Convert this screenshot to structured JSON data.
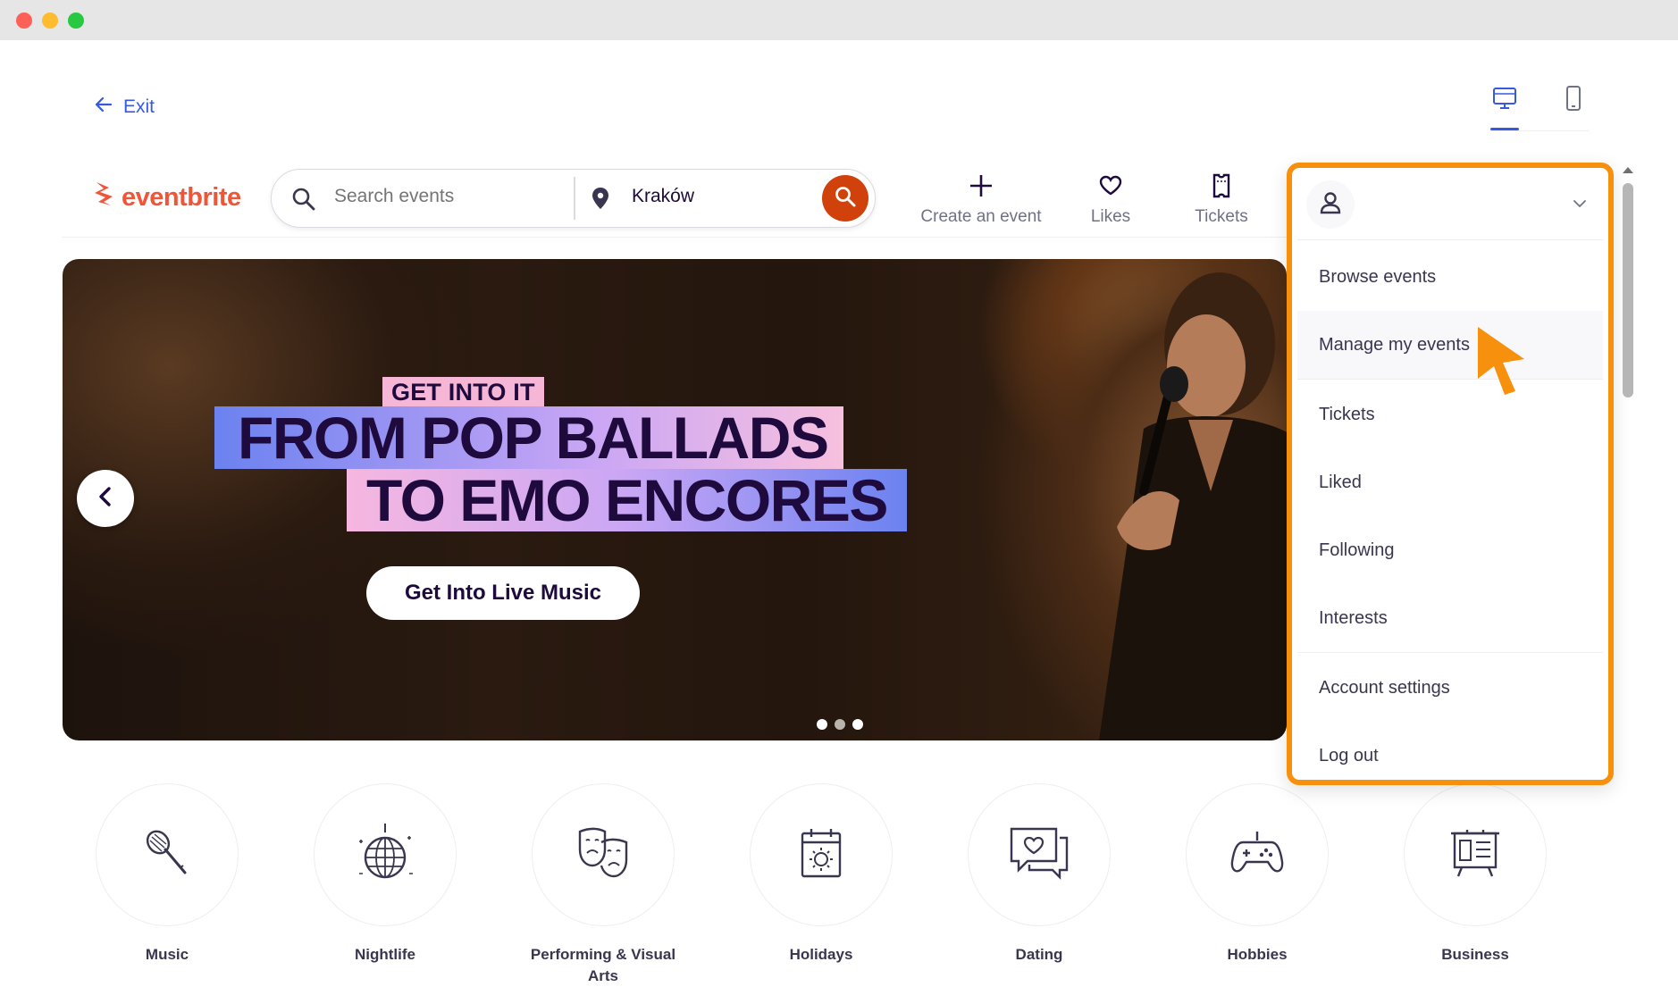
{
  "window": {
    "colors": {
      "close": "#fe5f57",
      "minimize": "#febc2e",
      "maximize": "#28c840"
    }
  },
  "topbar": {
    "exit_label": "Exit",
    "views": [
      {
        "name": "desktop",
        "active": true
      },
      {
        "name": "mobile",
        "active": false
      }
    ]
  },
  "header": {
    "logo_text": "eventbrite",
    "search": {
      "placeholder": "Search events",
      "value": ""
    },
    "location": {
      "value": "Kraków"
    },
    "nav": [
      {
        "label": "Create an event",
        "icon": "plus-icon"
      },
      {
        "label": "Likes",
        "icon": "heart-icon"
      },
      {
        "label": "Tickets",
        "icon": "ticket-icon"
      }
    ]
  },
  "hero": {
    "tag": "GET INTO IT",
    "headline_line1": "FROM POP BALLADS",
    "headline_line2": "TO EMO ENCORES",
    "cta_label": "Get Into Live Music",
    "slides_total": 3
  },
  "categories": [
    {
      "label": "Music",
      "icon": "microphone-icon"
    },
    {
      "label": "Nightlife",
      "icon": "disco-ball-icon"
    },
    {
      "label": "Performing & Visual Arts",
      "icon": "theater-masks-icon"
    },
    {
      "label": "Holidays",
      "icon": "calendar-icon"
    },
    {
      "label": "Dating",
      "icon": "chat-heart-icon"
    },
    {
      "label": "Hobbies",
      "icon": "gamepad-icon"
    },
    {
      "label": "Business",
      "icon": "presentation-icon"
    }
  ],
  "user_menu": {
    "items": [
      {
        "label": "Browse events"
      },
      {
        "label": "Manage my events",
        "hovered": true
      },
      {
        "label": "Tickets"
      },
      {
        "label": "Liked"
      },
      {
        "label": "Following"
      },
      {
        "label": "Interests"
      },
      {
        "label": "Account settings"
      },
      {
        "label": "Log out"
      }
    ],
    "highlight_color": "#f7900c"
  },
  "colors": {
    "brand": "#f05537",
    "link": "#3659e3",
    "search_button": "#d1410c",
    "text": "#1e0a3c"
  }
}
